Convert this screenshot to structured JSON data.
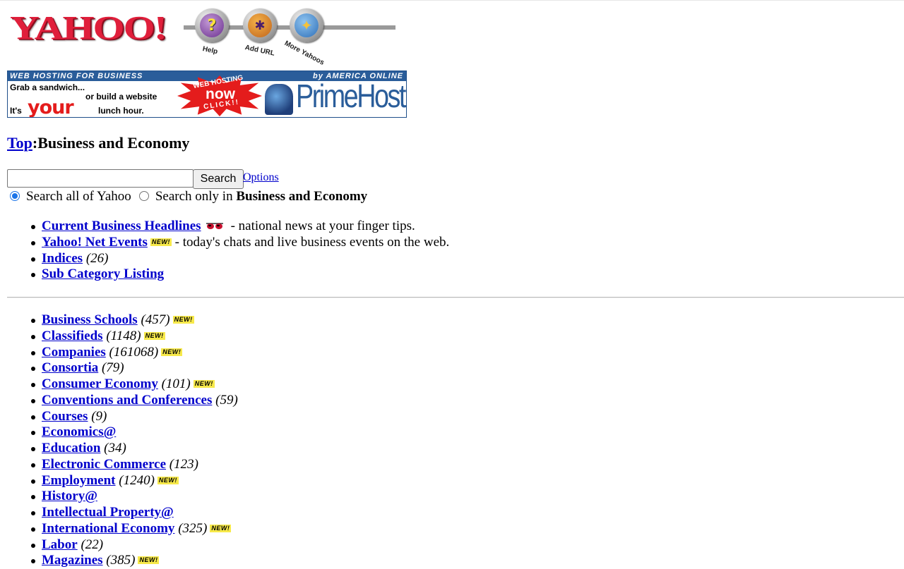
{
  "header": {
    "logo_text": "YAHOO!",
    "buttons": [
      {
        "label": "Help",
        "glyph": "?",
        "icon": "help-icon"
      },
      {
        "label": "Add URL",
        "glyph": "✱",
        "icon": "add-url-icon"
      },
      {
        "label": "More Yahoos",
        "glyph": "✦",
        "icon": "more-yahoos-icon"
      }
    ]
  },
  "banner": {
    "top_left": "WEB HOSTING FOR BUSINESS",
    "top_right": "by AMERICA ONLINE",
    "line1": "Grab a sandwich...",
    "line2": "or build a website",
    "line3_a": "It's",
    "line3_your": "your",
    "line3_b": "lunch hour.",
    "burst_line1": "WEB HOSTING",
    "burst_line2": "now",
    "burst_line3": "CLICK!!",
    "brand": "PrimeHost",
    "colors": {
      "bar": "#2a5d9a",
      "burst": "#e41c1c"
    }
  },
  "breadcrumb": {
    "top_link": "Top",
    "separator": ":",
    "current": "Business and Economy"
  },
  "search": {
    "input_value": "",
    "button_label": "Search",
    "options_link": "Options",
    "radio_all_label": "Search all of Yahoo",
    "radio_only_prefix": "Search only in",
    "radio_only_bold": "Business and Economy",
    "selected": "all"
  },
  "top_list": [
    {
      "label": "Current Business Headlines",
      "icon": "sunglasses-icon",
      "desc": "- national news at your finger tips."
    },
    {
      "label": "Yahoo! Net Events",
      "badge": "NEW!",
      "desc": "- today's chats and live business events on the web."
    },
    {
      "label": "Indices",
      "count": "(26)"
    },
    {
      "label": "Sub Category Listing"
    }
  ],
  "categories": [
    {
      "label": "Business Schools",
      "count": "(457)",
      "badge": "NEW!"
    },
    {
      "label": "Classifieds",
      "count": "(1148)",
      "badge": "NEW!"
    },
    {
      "label": "Companies",
      "count": "(161068)",
      "badge": "NEW!"
    },
    {
      "label": "Consortia",
      "count": "(79)"
    },
    {
      "label": "Consumer Economy",
      "count": "(101)",
      "badge": "NEW!"
    },
    {
      "label": "Conventions and Conferences",
      "count": "(59)"
    },
    {
      "label": "Courses",
      "count": "(9)"
    },
    {
      "label": "Economics@"
    },
    {
      "label": "Education",
      "count": "(34)"
    },
    {
      "label": "Electronic Commerce",
      "count": "(123)"
    },
    {
      "label": "Employment",
      "count": "(1240)",
      "badge": "NEW!"
    },
    {
      "label": "History@"
    },
    {
      "label": "Intellectual Property@"
    },
    {
      "label": "International Economy",
      "count": "(325)",
      "badge": "NEW!"
    },
    {
      "label": "Labor",
      "count": "(22)"
    },
    {
      "label": "Magazines",
      "count": "(385)",
      "badge": "NEW!"
    }
  ]
}
